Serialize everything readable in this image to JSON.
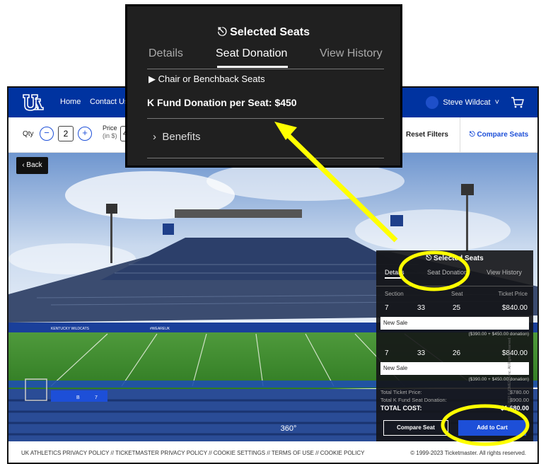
{
  "nav": {
    "home": "Home",
    "contact": "Contact Us",
    "user": "Steve Wildcat",
    "user_chevron": "˅"
  },
  "filters": {
    "qty_label": "Qty",
    "qty_value": "2",
    "minus": "−",
    "plus": "+",
    "price_label": "Price",
    "price_unit": "(in $)",
    "price_value_fragment": "4",
    "reset": "Reset Filters",
    "compare": "Compare Seats"
  },
  "back": "‹ Back",
  "view_360": "360°",
  "footer": {
    "links": "UK ATHLETICS PRIVACY POLICY  //  TICKETMASTER PRIVACY POLICY  //  COOKIE SETTINGS  //  TERMS OF USE  //  COOKIE POLICY",
    "copyright": "© 1999-2023 Ticketmaster. All rights reserved."
  },
  "panel": {
    "title": "Selected Seats",
    "tabs": [
      "Details",
      "Seat Donation",
      "View History"
    ],
    "cols": {
      "section": "Section",
      "seat": "Seat",
      "ticket_price": "Ticket Price"
    },
    "rows": [
      {
        "section": "7",
        "row": "33",
        "seat": "25",
        "price": "$840.00",
        "type": "New Sale",
        "note": "($390.00 + $450.00 donation)"
      },
      {
        "section": "7",
        "row": "33",
        "seat": "26",
        "price": "$840.00",
        "type": "New Sale",
        "note": "($390.00 + $450.00 donation)"
      }
    ],
    "total_ticket_label": "Total Ticket Price:",
    "total_ticket_value": "$780.00",
    "total_donation_label": "Total K Fund Seat Donation:",
    "total_donation_value": "$900.00",
    "total_cost_label": "TOTAL COST:",
    "total_cost_value": "$1,680.00",
    "compare_btn": "Compare Seat",
    "cart_btn": "Add to Cart",
    "copyright_vertical": "© 2023 © IOMEDIA Inc. All Rights Reserved"
  },
  "zoom": {
    "title": "Selected Seats",
    "tabs": [
      "Details",
      "Seat Donation",
      "View History"
    ],
    "chair": "Chair or Benchback Seats",
    "kfund": "K Fund Donation per Seat: $450",
    "benefits": "Benefits"
  },
  "stadium": {
    "banner_text": "KENTUCKY WILDCATS",
    "hashtag": "#WEAREUK",
    "section_signs": [
      "B",
      "7"
    ]
  },
  "colors": {
    "brand_blue": "#0033a0",
    "button_blue": "#1d4fd8",
    "highlight": "#ffff00"
  }
}
